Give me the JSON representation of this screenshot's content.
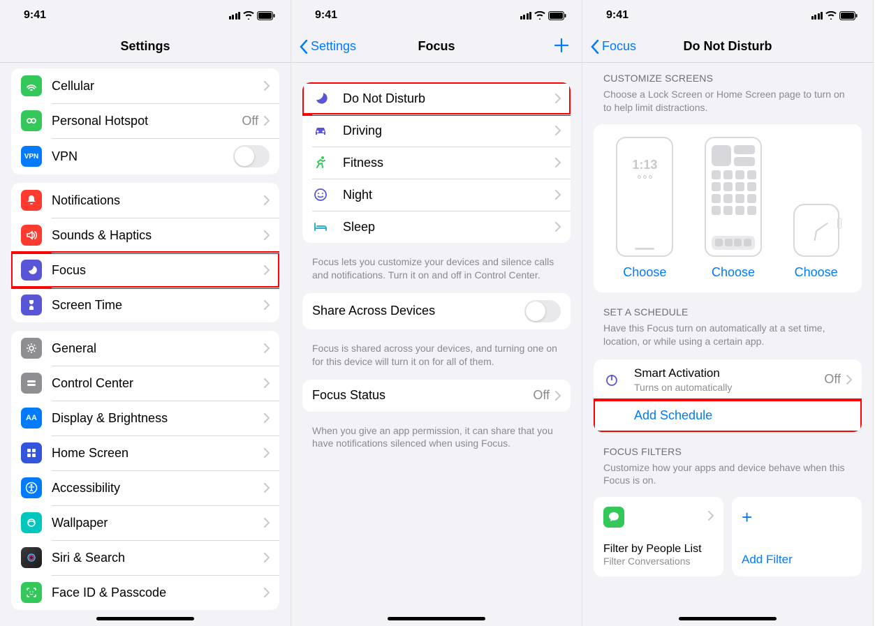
{
  "statusBar": {
    "time": "9:41"
  },
  "screen1": {
    "title": "Settings",
    "rows": {
      "cellular": "Cellular",
      "hotspot": "Personal Hotspot",
      "hotspotValue": "Off",
      "vpn": "VPN",
      "notifications": "Notifications",
      "sounds": "Sounds & Haptics",
      "focus": "Focus",
      "screenTime": "Screen Time",
      "general": "General",
      "controlCenter": "Control Center",
      "display": "Display & Brightness",
      "homeScreen": "Home Screen",
      "accessibility": "Accessibility",
      "wallpaper": "Wallpaper",
      "siri": "Siri & Search",
      "faceId": "Face ID & Passcode"
    }
  },
  "screen2": {
    "back": "Settings",
    "title": "Focus",
    "rows": {
      "dnd": "Do Not Disturb",
      "driving": "Driving",
      "fitness": "Fitness",
      "night": "Night",
      "sleep": "Sleep",
      "share": "Share Across Devices",
      "focusStatus": "Focus Status",
      "focusStatusValue": "Off"
    },
    "footer1": "Focus lets you customize your devices and silence calls and notifications. Turn it on and off in Control Center.",
    "footer2": "Focus is shared across your devices, and turning one on for this device will turn it on for all of them.",
    "footer3": "When you give an app permission, it can share that you have notifications silenced when using Focus."
  },
  "screen3": {
    "back": "Focus",
    "title": "Do Not Disturb",
    "customizeHeader": "CUSTOMIZE SCREENS",
    "customizeFooter": "Choose a Lock Screen or Home Screen page to turn on to help limit distractions.",
    "lockTime": "1:13",
    "choose": "Choose",
    "scheduleHeader": "SET A SCHEDULE",
    "scheduleFooter": "Have this Focus turn on automatically at a set time, location, or while using a certain app.",
    "smartTitle": "Smart Activation",
    "smartSub": "Turns on automatically",
    "smartValue": "Off",
    "addSchedule": "Add Schedule",
    "filtersHeader": "FOCUS FILTERS",
    "filtersFooter": "Customize how your apps and device behave when this Focus is on.",
    "filterTitle": "Filter by People List",
    "filterSub": "Filter Conversations",
    "addFilter": "Add Filter"
  }
}
